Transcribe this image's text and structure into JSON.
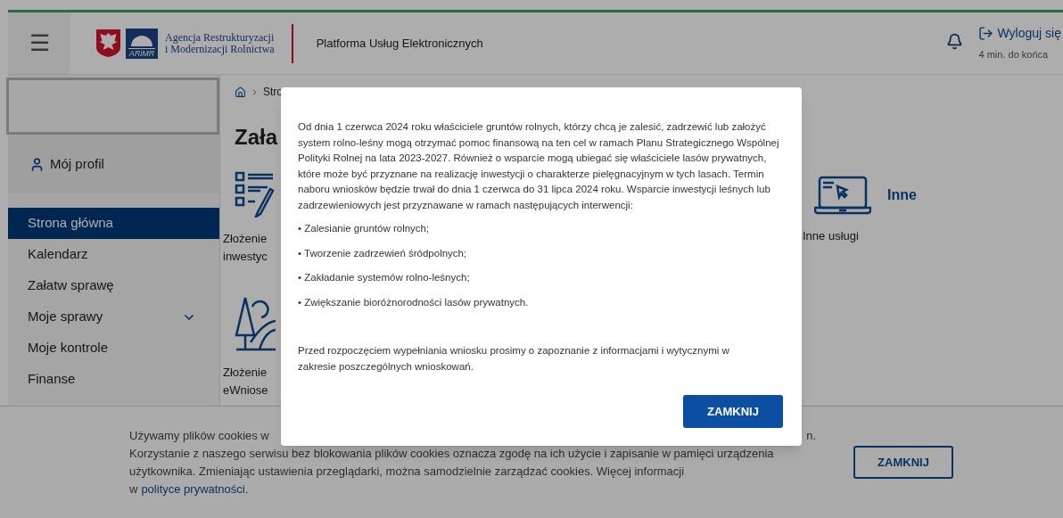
{
  "header": {
    "menu_label": "☰",
    "logo_mark": "ARiMR",
    "agency_lines": [
      "Agencja Restrukturyzacji",
      "i Modernizacji Rolnictwa"
    ],
    "platform_title": "Platforma Usług Elektronicznych",
    "logout": "Wyloguj się",
    "session": "4 min. do końca"
  },
  "sidebar": {
    "profile": "Mój profil",
    "items": [
      {
        "label": "Strona główna",
        "selected": true,
        "expandable": false
      },
      {
        "label": "Kalendarz",
        "selected": false,
        "expandable": false
      },
      {
        "label": "Załatw sprawę",
        "selected": false,
        "expandable": false
      },
      {
        "label": "Moje sprawy",
        "selected": false,
        "expandable": true
      },
      {
        "label": "Moje kontrole",
        "selected": false,
        "expandable": false
      },
      {
        "label": "Finanse",
        "selected": false,
        "expandable": false
      }
    ]
  },
  "content": {
    "breadcrumb": "Stro",
    "heading": "Zała",
    "cards": [
      {
        "kind": "checklist",
        "lines": [
          "Złożenie",
          "inwestyc"
        ]
      },
      {
        "kind": "forest",
        "lines": [
          "Złożenie",
          "eWniose"
        ]
      },
      {
        "kind": "laptop",
        "title": "Inne",
        "lines": [
          "Inne usługi"
        ]
      }
    ]
  },
  "modal": {
    "intro": "Od dnia 1 czerwca 2024 roku właściciele gruntów rolnych, którzy chcą je zalesić, zadrzewić lub założyć system rolno-leśny mogą otrzymać pomoc finansową na ten cel w ramach Planu Strategicznego Wspólnej Polityki Rolnej na lata 2023-2027. Również o wsparcie mogą ubiegać się właściciele lasów prywatnych, które może być przyznane na realizację inwestycji o charakterze pielęgnacyjnym w tych lasach. Termin naboru wniosków będzie trwał do dnia 1 czerwca do 31 lipca 2024 roku. Wsparcie inwestycji leśnych lub zadrzewieniowych jest przyznawane w ramach następujących interwencji:",
    "bullets": [
      "• Zalesianie gruntów rolnych;",
      "• Tworzenie zadrzewień śródpolnych;",
      "• Zakładanie systemów rolno-leśnych;",
      "• Zwiększanie bioróżnorodności lasów prywatnych."
    ],
    "closing": "Przed rozpoczęciem wypełniania wniosku prosimy o zapoznanie z informacjami i wytycznymi w zakresie poszczególnych wnioskowań.",
    "button": "ZAMKNIJ"
  },
  "cookie_banner": {
    "line_1_start": "Używamy plików cookies w",
    "line_1_end": "n.",
    "lines": [
      "Korzystanie z naszego serwisu bez blokowania plików cookies oznacza zgodę na ich użycie i zapisanie w pamięci urządzenia",
      "użytkownika. Zmieniając ustawienia przeglądarki, można samodzielnie zarządzać cookies. Więcej informacji"
    ],
    "link_prefix": "w",
    "link": "polityce prywatności.",
    "button": "ZAMKNIJ"
  }
}
